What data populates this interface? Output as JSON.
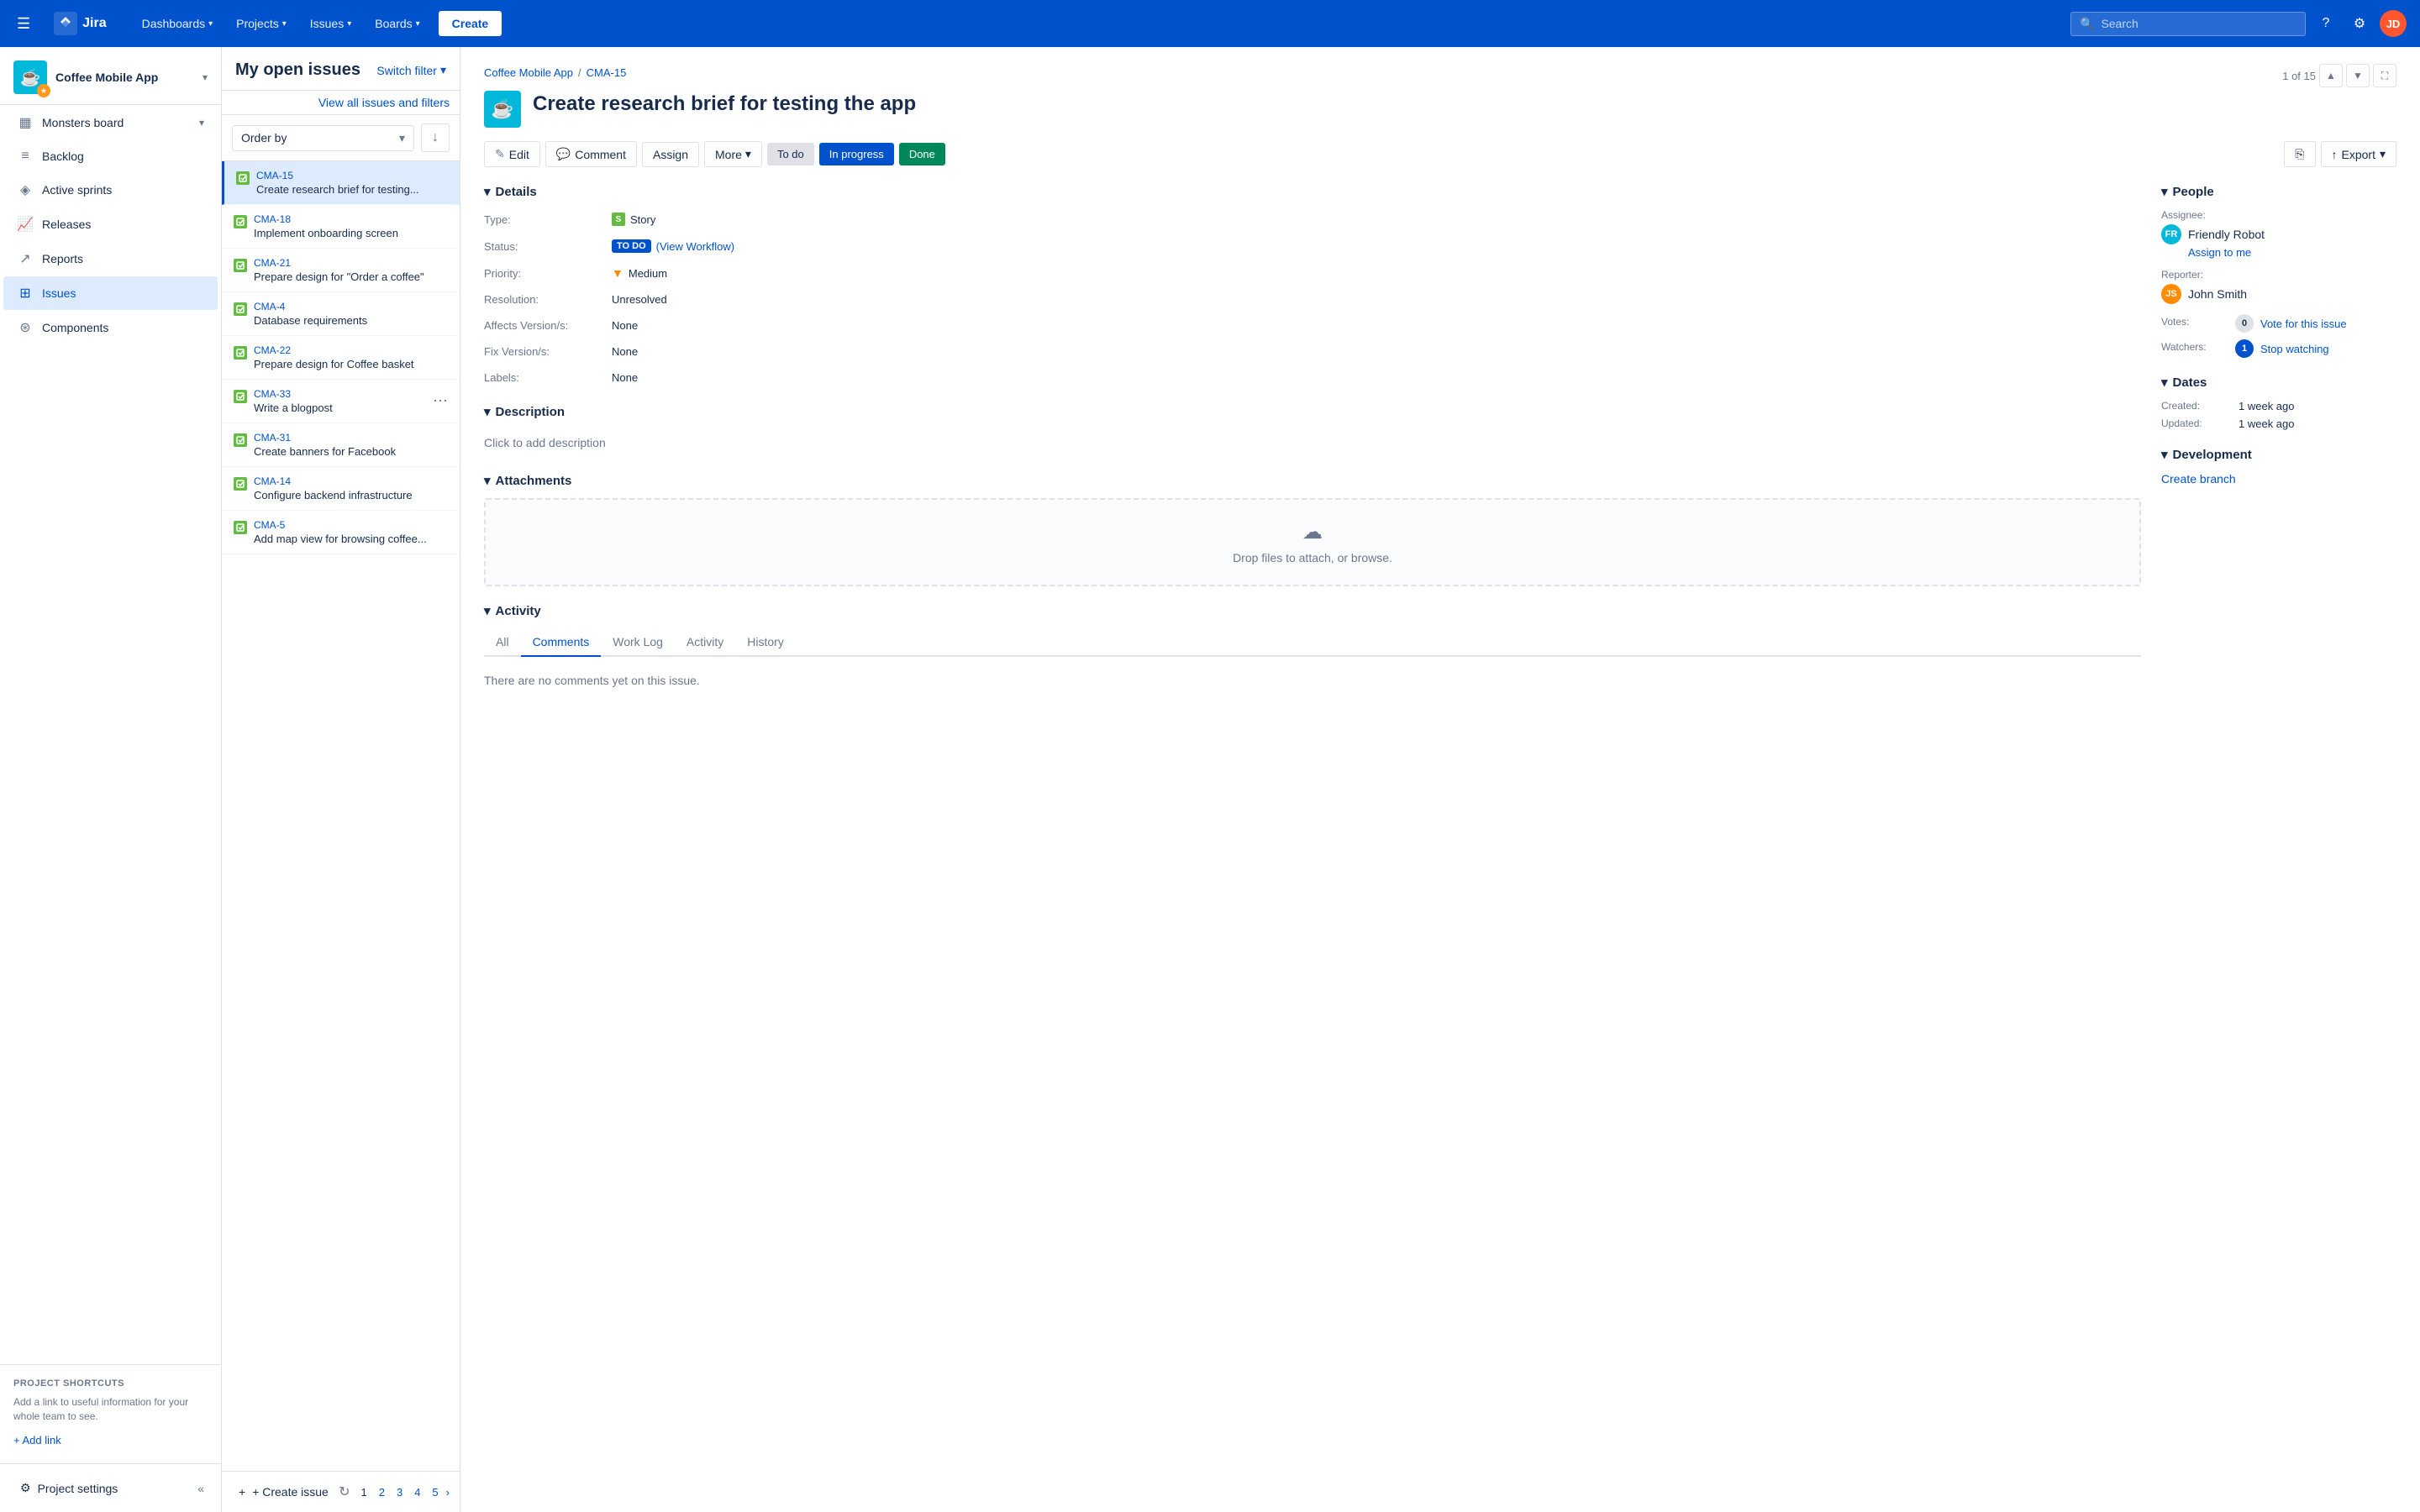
{
  "nav": {
    "logo_text": "Jira",
    "hamburger_label": "☰",
    "items": [
      {
        "label": "Dashboards",
        "id": "dashboards"
      },
      {
        "label": "Projects",
        "id": "projects"
      },
      {
        "label": "Issues",
        "id": "issues"
      },
      {
        "label": "Boards",
        "id": "boards"
      }
    ],
    "create_label": "Create",
    "search_placeholder": "Search",
    "help_icon": "?",
    "settings_icon": "⚙",
    "avatar_text": "JD"
  },
  "sidebar": {
    "project_name": "Coffee Mobile App",
    "project_icon": "☕",
    "nav_items": [
      {
        "label": "Monsters board",
        "icon": "▦",
        "id": "board",
        "active": false,
        "has_chevron": true
      },
      {
        "label": "Backlog",
        "icon": "≡",
        "id": "backlog",
        "active": false
      },
      {
        "label": "Active sprints",
        "icon": "◈",
        "id": "active-sprints",
        "active": false
      },
      {
        "label": "Releases",
        "icon": "📈",
        "id": "releases",
        "active": false
      },
      {
        "label": "Reports",
        "icon": "↗",
        "id": "reports",
        "active": false
      },
      {
        "label": "Issues",
        "icon": "⊞",
        "id": "issues",
        "active": true
      },
      {
        "label": "Components",
        "icon": "⊛",
        "id": "components",
        "active": false
      }
    ],
    "shortcuts_title": "PROJECT SHORTCUTS",
    "shortcuts_desc": "Add a link to useful information for your whole team to see.",
    "add_link_label": "+ Add link",
    "project_settings_label": "Project settings",
    "collapse_icon": "«"
  },
  "issues_panel": {
    "title": "My open issues",
    "switch_filter_label": "Switch filter",
    "view_all_label": "View all issues and filters",
    "order_by_label": "Order by",
    "issues": [
      {
        "key": "CMA-15",
        "summary": "Create research brief for testing...",
        "id": "cma-15",
        "selected": true
      },
      {
        "key": "CMA-18",
        "summary": "Implement onboarding screen",
        "id": "cma-18"
      },
      {
        "key": "CMA-21",
        "summary": "Prepare design for \"Order a coffee\"",
        "id": "cma-21"
      },
      {
        "key": "CMA-4",
        "summary": "Database requirements",
        "id": "cma-4"
      },
      {
        "key": "CMA-22",
        "summary": "Prepare design for Coffee basket",
        "id": "cma-22"
      },
      {
        "key": "CMA-33",
        "summary": "Write a blogpost",
        "id": "cma-33"
      },
      {
        "key": "CMA-31",
        "summary": "Create banners for Facebook",
        "id": "cma-31"
      },
      {
        "key": "CMA-14",
        "summary": "Configure backend infrastructure",
        "id": "cma-14"
      },
      {
        "key": "CMA-5",
        "summary": "Add map view for browsing coffee...",
        "id": "cma-5"
      }
    ],
    "create_issue_label": "+ Create issue",
    "pagination": {
      "current": "1",
      "pages": [
        "1",
        "2",
        "3",
        "4",
        "5"
      ],
      "next_icon": "›"
    },
    "refresh_icon": "↻"
  },
  "issue_detail": {
    "breadcrumb_project": "Coffee Mobile App",
    "breadcrumb_issue": "CMA-15",
    "title": "Create research brief for testing the app",
    "nav_count": "1 of 15",
    "actions": {
      "edit_label": "Edit",
      "comment_label": "Comment",
      "assign_label": "Assign",
      "more_label": "More",
      "todo_label": "To do",
      "inprogress_label": "In progress",
      "done_label": "Done",
      "share_label": "Share",
      "export_label": "Export"
    },
    "details": {
      "type_label": "Type:",
      "type_value": "Story",
      "status_label": "Status:",
      "status_value": "TO DO",
      "workflow_label": "(View Workflow)",
      "priority_label": "Priority:",
      "priority_value": "Medium",
      "resolution_label": "Resolution:",
      "resolution_value": "Unresolved",
      "affects_label": "Affects Version/s:",
      "affects_value": "None",
      "fix_label": "Fix Version/s:",
      "fix_value": "None",
      "labels_label": "Labels:",
      "labels_value": "None"
    },
    "description": {
      "section_title": "Description",
      "placeholder": "Click to add description"
    },
    "attachments": {
      "section_title": "Attachments",
      "dropzone_text": "Drop files to attach, or browse."
    },
    "activity": {
      "section_title": "Activity",
      "tabs": [
        "All",
        "Comments",
        "Work Log",
        "Activity",
        "History"
      ],
      "active_tab": "Comments",
      "no_comments": "There are no comments yet on this issue."
    },
    "people": {
      "assignee_label": "Assignee:",
      "assignee_name": "Friendly Robot",
      "assign_to_me": "Assign to me",
      "reporter_label": "Reporter:",
      "reporter_name": "John Smith",
      "votes_label": "Votes:",
      "votes_count": "0",
      "vote_link": "Vote for this issue",
      "watchers_label": "Watchers:",
      "watchers_count": "1",
      "watch_link": "Stop watching"
    },
    "dates": {
      "section_title": "Dates",
      "created_label": "Created:",
      "created_value": "1 week ago",
      "updated_label": "Updated:",
      "updated_value": "1 week ago"
    },
    "development": {
      "section_title": "Development",
      "create_branch_label": "Create branch"
    }
  }
}
